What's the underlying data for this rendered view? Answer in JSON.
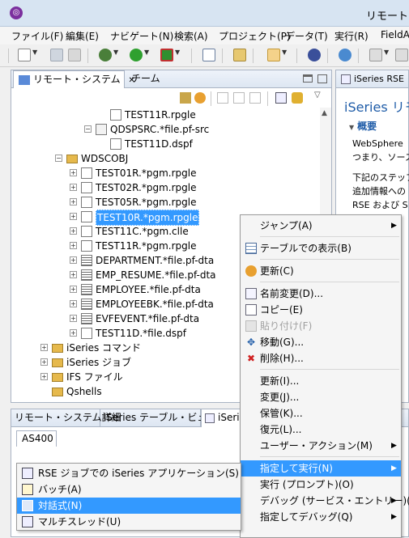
{
  "window": {
    "title": "リモート・",
    "app_icon": "eclipse-icon"
  },
  "menubar": [
    "ファイル(F)",
    "編集(E)",
    "ナビゲート(N)",
    "検索(A)",
    "プロジェクト(P)",
    "データ(T)",
    "実行(R)",
    "FieldA"
  ],
  "left_view": {
    "tabs": [
      {
        "label": "リモート・システム",
        "active": true,
        "close": "✕"
      },
      {
        "label": "チーム",
        "active": false
      }
    ]
  },
  "tree": {
    "rows": [
      {
        "label": "TEST11R.rpgle",
        "kind": "member"
      },
      {
        "label": "QDSPSRC.*file.pf-src",
        "kind": "srcfile",
        "expander": "−"
      },
      {
        "label": "TEST11D.dspf",
        "kind": "member"
      },
      {
        "label": "WDSCOBJ",
        "kind": "library",
        "expander": "−"
      },
      {
        "label": "TEST01R.*pgm.rpgle",
        "kind": "pgm",
        "expander": "+"
      },
      {
        "label": "TEST02R.*pgm.rpgle",
        "kind": "pgm",
        "expander": "+"
      },
      {
        "label": "TEST05R.*pgm.rpgle",
        "kind": "pgm",
        "expander": "+"
      },
      {
        "label": "TEST10R.*pgm.rpgle",
        "kind": "pgm",
        "expander": "+",
        "selected": true
      },
      {
        "label": "TEST11C.*pgm.clle",
        "kind": "pgm",
        "expander": "+"
      },
      {
        "label": "TEST11R.*pgm.rpgle",
        "kind": "pgm",
        "expander": "+"
      },
      {
        "label": "DEPARTMENT.*file.pf-dta",
        "kind": "file",
        "expander": "+"
      },
      {
        "label": "EMP_RESUME.*file.pf-dta",
        "kind": "file",
        "expander": "+"
      },
      {
        "label": "EMPLOYEE.*file.pf-dta",
        "kind": "file",
        "expander": "+"
      },
      {
        "label": "EMPLOYEEBK.*file.pf-dta",
        "kind": "file",
        "expander": "+"
      },
      {
        "label": "EVFEVENT.*file.pf-dta",
        "kind": "file",
        "expander": "+"
      },
      {
        "label": "TEST11D.*file.dspf",
        "kind": "dspf",
        "expander": "+"
      },
      {
        "label": "iSeries コマンド",
        "kind": "subsystem",
        "expander": "+"
      },
      {
        "label": "iSeries ジョブ",
        "kind": "subsystem",
        "expander": "+"
      },
      {
        "label": "IFS ファイル",
        "kind": "subsystem",
        "expander": "+"
      },
      {
        "label": "Qshells",
        "kind": "subsystem"
      }
    ]
  },
  "right_view": {
    "tab_label": "iSeries RSE",
    "title": "iSeries リモ",
    "section": "概要",
    "body_lines": [
      "WebSphere",
      "つまり、ソース・",
      "",
      "下記のステップ",
      "追加情報への",
      "RSE および S"
    ]
  },
  "bottom_view": {
    "tabs": [
      "リモート・システム詳細",
      "iSeries テーブル・ビュー",
      "iSeri"
    ],
    "subtab": "AS400"
  },
  "context_menu": {
    "items": [
      {
        "label": "ジャンプ(A)",
        "submenu": true
      },
      {
        "separator": true
      },
      {
        "label": "テーブルでの表示(B)",
        "icon": "table-icon"
      },
      {
        "separator": true
      },
      {
        "label": "更新(C)",
        "icon": "refresh-icon"
      },
      {
        "separator": true
      },
      {
        "label": "名前変更(D)...",
        "icon": "rename-icon"
      },
      {
        "label": "コピー(E)",
        "icon": "copy-icon"
      },
      {
        "label": "貼り付け(F)",
        "icon": "paste-icon",
        "disabled": true
      },
      {
        "label": "移動(G)...",
        "icon": "move-icon"
      },
      {
        "label": "削除(H)...",
        "icon": "delete-icon"
      },
      {
        "separator": true
      },
      {
        "label": "更新(I)..."
      },
      {
        "label": "変更(J)..."
      },
      {
        "label": "保管(K)..."
      },
      {
        "label": "復元(L)..."
      },
      {
        "label": "ユーザー・アクション(M)",
        "submenu": true
      },
      {
        "separator": true
      },
      {
        "label": "指定して実行(N)",
        "submenu": true,
        "highlighted": true
      },
      {
        "label": "実行 (プロンプト)(O)"
      },
      {
        "label": "デバッグ (サービス・エントリー)(P)",
        "submenu": true
      },
      {
        "label": "指定してデバッグ(Q)",
        "submenu": true
      }
    ]
  },
  "submenu": {
    "items": [
      {
        "label": "RSE ジョブでの iSeries アプリケーション(S)",
        "icon": "rse-job-icon"
      },
      {
        "label": "バッチ(A)",
        "icon": "batch-icon"
      },
      {
        "label": "対話式(N)",
        "icon": "interactive-icon",
        "highlighted": true
      },
      {
        "label": "マルチスレッド(U)",
        "icon": "multithread-icon"
      }
    ]
  },
  "colors": {
    "accent": "#3399ff",
    "title_bg": "#d7e4f2",
    "link_blue": "#1f5ca8",
    "delete_red": "#d02020"
  }
}
